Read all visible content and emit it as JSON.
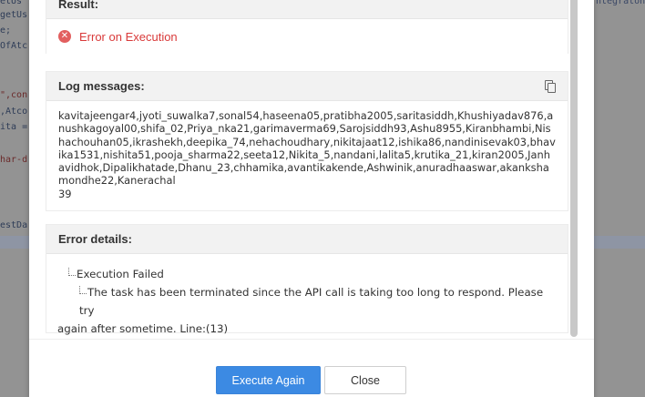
{
  "background_code": {
    "lines": [
      {
        "text": "etUs",
        "kind": "normal"
      },
      {
        "text": "getUs",
        "kind": "normal"
      },
      {
        "text": "e;",
        "kind": "normal"
      },
      {
        "text": "OfAtc",
        "kind": "normal"
      },
      {
        "text": "\",con",
        "kind": "str"
      },
      {
        "text": ",Atco",
        "kind": "normal"
      },
      {
        "text": "ita =",
        "kind": "normal"
      },
      {
        "text": "har-d",
        "kind": "str"
      },
      {
        "text": "estDa",
        "kind": "normal"
      }
    ],
    "right_snippet": "ntegraton"
  },
  "modal": {
    "result": {
      "header": "Result:",
      "status_text": "Error on Execution"
    },
    "log": {
      "header": "Log messages:",
      "text": "kavitajeengar4,jyoti_suwalka7,sonal54,haseena05,pratibha2005,saritasiddh,Khushiyadav876,anushkagoyal00,shifa_02,Priya_nka21,garimaverma69,Sarojsiddh93,Ashu8955,Kiranbhambi,Nishachouhan05,ikrashekh,deepika_74,nehachoudhary,nikitajaat12,ishika86,nandinisevak03,bhavika1531,nishita51,pooja_sharma22,seeta12,Nikita_5,nandani,lalita5,krutika_21,kiran2005,Janhavidhok,Dipalikhatade,Dhanu_23,chhamika,avantikakende,Ashwinik,anuradhaaswar,akankshamondhe22,Kanerachal",
      "count": "39"
    },
    "error": {
      "header": "Error details:",
      "level1": "Execution Failed",
      "level2_line1": "The task has been terminated since the API call is taking too long to respond. Please try",
      "level2_line2": "again after sometime. Line:(13)"
    },
    "buttons": {
      "execute_again": "Execute Again",
      "close": "Close"
    }
  },
  "colors": {
    "accent": "#3c8ae3",
    "error": "#d93a3a"
  }
}
